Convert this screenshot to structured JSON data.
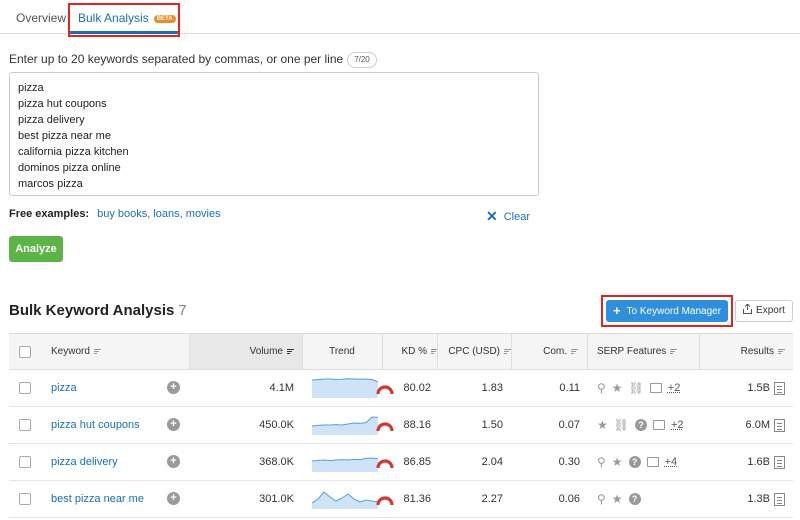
{
  "tabs": [
    {
      "label": "Overview"
    },
    {
      "label": "Bulk Analysis",
      "badge": "BETA"
    }
  ],
  "input": {
    "instructions": "Enter up to 20 keywords separated by commas, or one per line",
    "counter": "7/20",
    "value": "pizza\npizza hut coupons\npizza delivery\nbest pizza near me\ncalifornia pizza kitchen\ndominos pizza online\nmarcos pizza"
  },
  "free_examples": {
    "label": "Free examples:",
    "link": "buy books, loans, movies"
  },
  "clear_label": "Clear",
  "analyze_label": "Analyze",
  "results": {
    "title": "Bulk Keyword Analysis",
    "count": "7",
    "keyword_manager_label": "To Keyword Manager",
    "export_label": "Export",
    "columns": {
      "keyword": "Keyword",
      "volume": "Volume",
      "trend": "Trend",
      "kd": "KD %",
      "cpc": "CPC (USD)",
      "com": "Com.",
      "serp": "SERP Features",
      "results": "Results"
    },
    "rows": [
      {
        "keyword": "pizza",
        "volume": "4.1M",
        "kd": "80.02",
        "cpc": "1.83",
        "com": "0.11",
        "serp_more": "+2",
        "results": "1.5B",
        "trend": [
          0.9,
          0.92,
          0.95,
          0.95,
          0.93,
          0.94,
          0.96,
          0.95,
          0.94,
          0.95,
          0.92,
          0.8
        ]
      },
      {
        "keyword": "pizza hut coupons",
        "volume": "450.0K",
        "kd": "88.16",
        "cpc": "1.50",
        "com": "0.07",
        "serp_more": "+2",
        "results": "6.0M",
        "trend": [
          0.45,
          0.48,
          0.5,
          0.5,
          0.52,
          0.5,
          0.55,
          0.6,
          0.58,
          0.62,
          0.9,
          0.88
        ]
      },
      {
        "keyword": "pizza delivery",
        "volume": "368.0K",
        "kd": "86.85",
        "cpc": "2.04",
        "com": "0.30",
        "serp_more": "+4",
        "results": "1.6B",
        "trend": [
          0.55,
          0.58,
          0.6,
          0.57,
          0.6,
          0.62,
          0.6,
          0.63,
          0.62,
          0.68,
          0.7,
          0.66
        ]
      },
      {
        "keyword": "best pizza near me",
        "volume": "301.0K",
        "kd": "81.36",
        "cpc": "2.27",
        "com": "0.06",
        "serp_more": "",
        "results": "1.3B",
        "trend": [
          0.3,
          0.5,
          0.85,
          0.6,
          0.4,
          0.55,
          0.75,
          0.5,
          0.35,
          0.45,
          0.4,
          0.35
        ]
      }
    ]
  },
  "colors": {
    "accent": "#1a6fb5",
    "analyze": "#5cb346",
    "keyword_manager": "#2f8fdc",
    "highlight": "#e02424",
    "kd_gauge": "#d9352f",
    "trend_fill": "#cfe3f6",
    "trend_line": "#5a9bd8"
  }
}
